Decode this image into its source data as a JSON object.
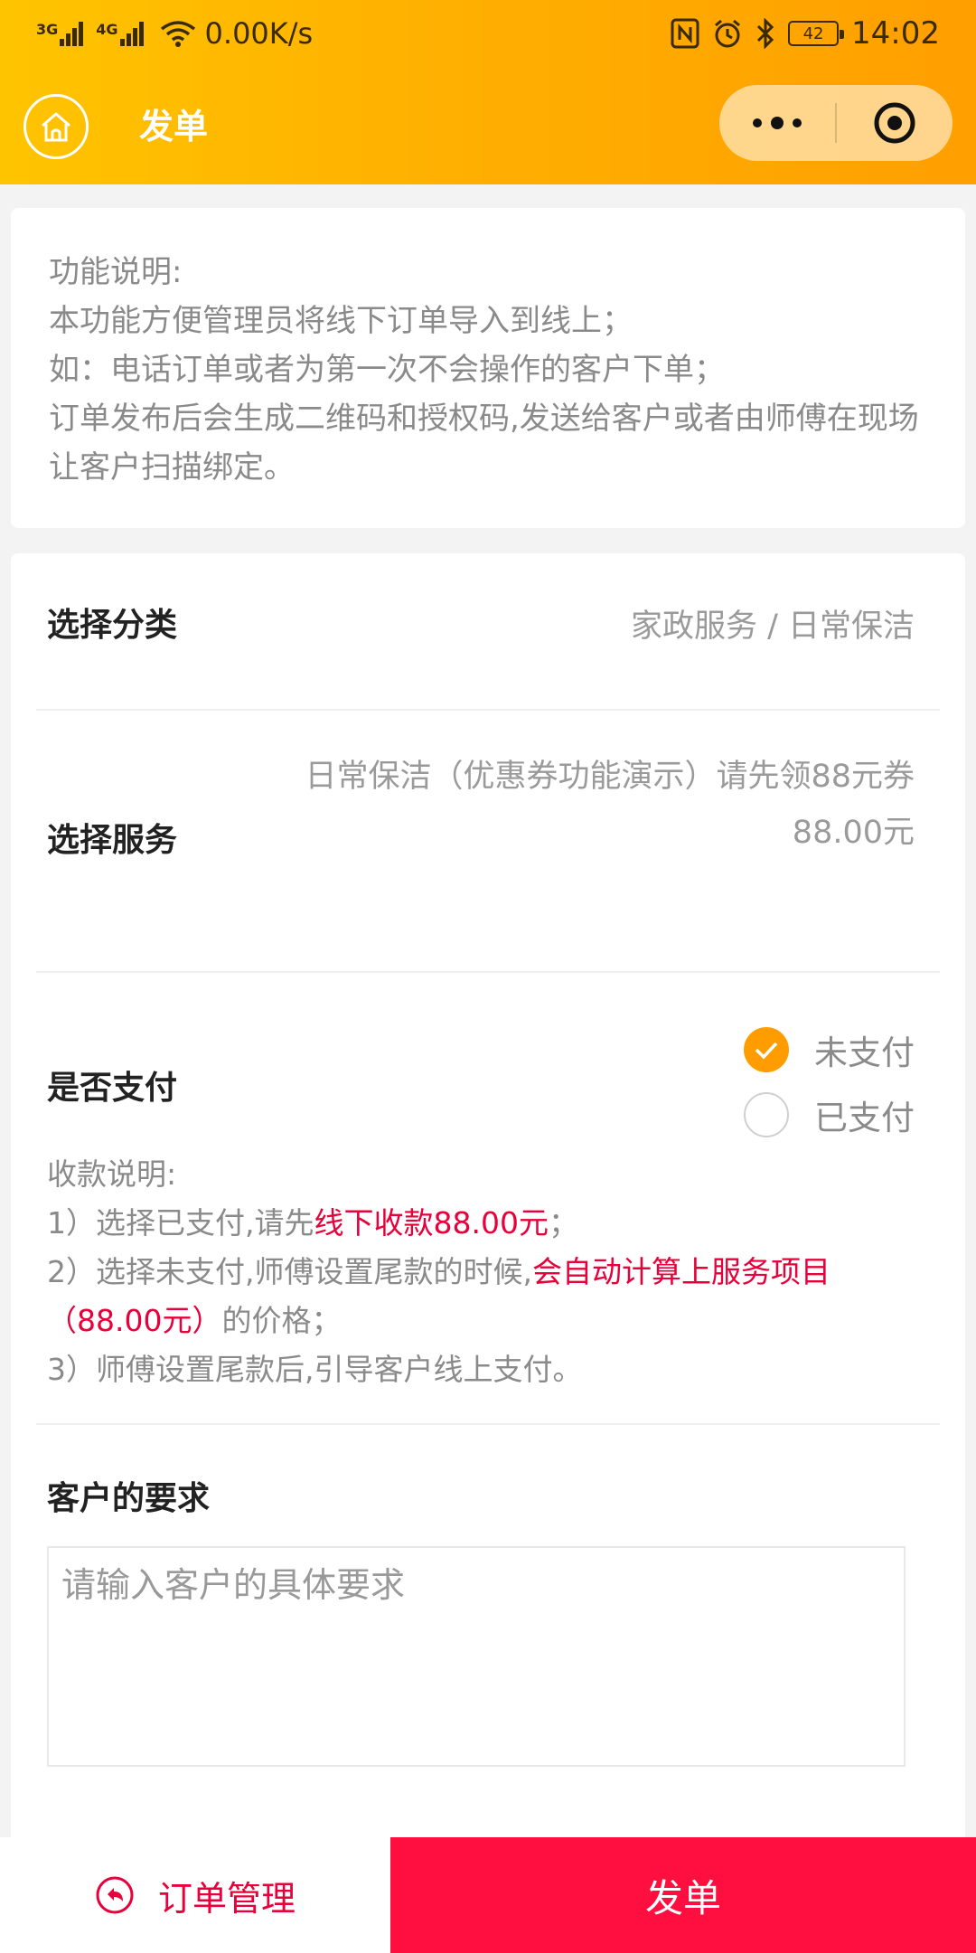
{
  "status_bar": {
    "net1": "3G",
    "net2": "4G",
    "speed": "0.00K/s",
    "battery": "42",
    "time": "14:02"
  },
  "nav": {
    "title": "发单"
  },
  "notice": {
    "lines": [
      "功能说明:",
      "本功能方便管理员将线下订单导入到线上；",
      "如：电话订单或者为第一次不会操作的客户下单；",
      "订单发布后会生成二维码和授权码,发送给客户或者由师傅在现场让客户扫描绑定。"
    ]
  },
  "category": {
    "label": "选择分类",
    "value": "家政服务 / 日常保洁"
  },
  "service": {
    "label": "选择服务",
    "name": "日常保洁（优惠券功能演示）请先领88元券",
    "price": "88.00元"
  },
  "payment": {
    "label": "是否支付",
    "options": [
      {
        "label": "未支付",
        "selected": true
      },
      {
        "label": "已支付",
        "selected": false
      }
    ],
    "note_title": "收款说明:",
    "note1_prefix": "1）选择已支付,请先",
    "note1_highlight": "线下收款88.00元",
    "note1_suffix": "；",
    "note2_prefix": "2）选择未支付,师傅设置尾款的时候,",
    "note2_highlight": "会自动计算上服务项目（88.00元）",
    "note2_suffix": "的价格；",
    "note3": "3）师傅设置尾款后,引导客户线上支付。"
  },
  "requirement": {
    "label": "客户的要求",
    "placeholder": "请输入客户的具体要求"
  },
  "bottom": {
    "orders_label": "订单管理",
    "submit_label": "发单"
  },
  "colors": {
    "header_start": "#ffc400",
    "header_end": "#ff9f00",
    "accent_red": "#e8003a",
    "submit_bg": "#ff0f3f",
    "radio_on": "#ff9d00"
  }
}
